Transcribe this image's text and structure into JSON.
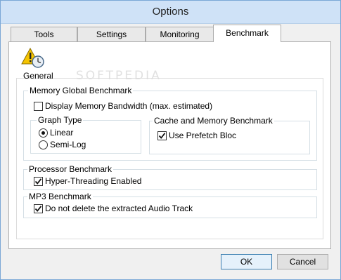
{
  "window": {
    "title": "Options"
  },
  "tabs": [
    {
      "label": "Tools"
    },
    {
      "label": "Settings"
    },
    {
      "label": "Monitoring"
    },
    {
      "label": "Benchmark",
      "active": true
    }
  ],
  "watermark": "SOFTPEDIA",
  "general": {
    "label": "General",
    "memory_global": {
      "title": "Memory Global Benchmark",
      "display_bandwidth": {
        "label": "Display Memory Bandwidth (max. estimated)",
        "checked": false
      },
      "graph_type": {
        "title": "Graph Type",
        "options": [
          {
            "label": "Linear",
            "selected": true
          },
          {
            "label": "Semi-Log",
            "selected": false
          }
        ]
      },
      "cache_memory": {
        "title": "Cache and Memory Benchmark",
        "use_prefetch": {
          "label": "Use Prefetch Bloc",
          "checked": true
        }
      }
    },
    "processor": {
      "title": "Processor Benchmark",
      "hyper_threading": {
        "label": "Hyper-Threading Enabled",
        "checked": true
      }
    },
    "mp3": {
      "title": "MP3 Benchmark",
      "keep_audio": {
        "label": "Do not delete the extracted Audio Track",
        "checked": true
      }
    }
  },
  "buttons": {
    "ok": "OK",
    "cancel": "Cancel"
  },
  "icons": {
    "general": "warning-clock-icon",
    "check": "checkmark-icon"
  },
  "colors": {
    "titlebar": "#cfe2f7",
    "border": "#7aa7d6",
    "panel": "#ffffff"
  }
}
